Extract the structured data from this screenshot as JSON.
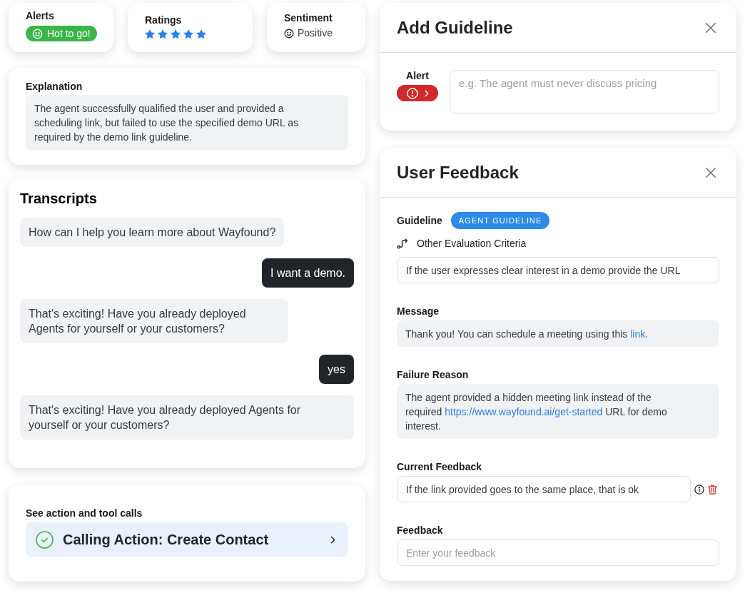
{
  "summary_cards": [
    {
      "kind": "alert",
      "label": "Alerts",
      "badge": "Hot to go!"
    },
    {
      "kind": "rating",
      "label": "Ratings",
      "stars": 5
    },
    {
      "kind": "sentiment",
      "label": "Sentiment",
      "value": "Positive"
    }
  ],
  "explanation": {
    "label": "Explanation",
    "text": "The agent successfully qualified the user and provided a scheduling link, but failed to use the specified demo URL as required by the demo link guideline."
  },
  "transcripts": {
    "title": "Transcripts",
    "messages": [
      {
        "kind": "agent",
        "text": "How can I help you learn more about Wayfound?"
      },
      {
        "kind": "user",
        "text": "I want a demo."
      },
      {
        "kind": "agent",
        "text": "That's exciting! Have you already deployed Agents for yourself or your customers?"
      },
      {
        "kind": "user",
        "text": "yes"
      },
      {
        "kind": "agent",
        "text": "That's exciting! Have you already deployed Agents for yourself or your customers?"
      }
    ]
  },
  "actions": {
    "label": "See action and tool calls",
    "items": [
      {
        "text": "Calling Action: Create Contact",
        "completed": true
      }
    ]
  },
  "add_guideline": {
    "title": "Add Guideline",
    "alert_label": "Alert",
    "guideline_field": {
      "placeholder": "e.g. The agent must never discuss pricing"
    }
  },
  "user_feedback": {
    "title": "User Feedback",
    "guideline_label": "Guideline",
    "guideline_badge": "AGENT GUIDELINE",
    "criteria": "Other Evaluation Criteria",
    "guideline_field": {
      "value": "If the user expresses clear interest in a demo provide the URL"
    },
    "sections": [
      {
        "kind": "text",
        "label": "Message",
        "parts": [
          {
            "kind": "text",
            "text": "Thank you! You can schedule a meeting using this "
          },
          {
            "kind": "link",
            "text": "link"
          },
          {
            "kind": "text",
            "text": "."
          }
        ]
      },
      {
        "kind": "text",
        "label": "Failure Reason",
        "parts": [
          {
            "kind": "text",
            "text": "The agent provided a hidden meeting link instead of the required "
          },
          {
            "kind": "link",
            "text": "https://www.wayfound.ai/get-started"
          },
          {
            "kind": "text",
            "text": " URL for demo interest."
          }
        ]
      },
      {
        "kind": "current",
        "label": "Current Feedback",
        "value": "If the link provided goes to the same place, that is ok"
      },
      {
        "kind": "input",
        "label": "Feedback",
        "placeholder": "Enter your feedback"
      }
    ]
  }
}
